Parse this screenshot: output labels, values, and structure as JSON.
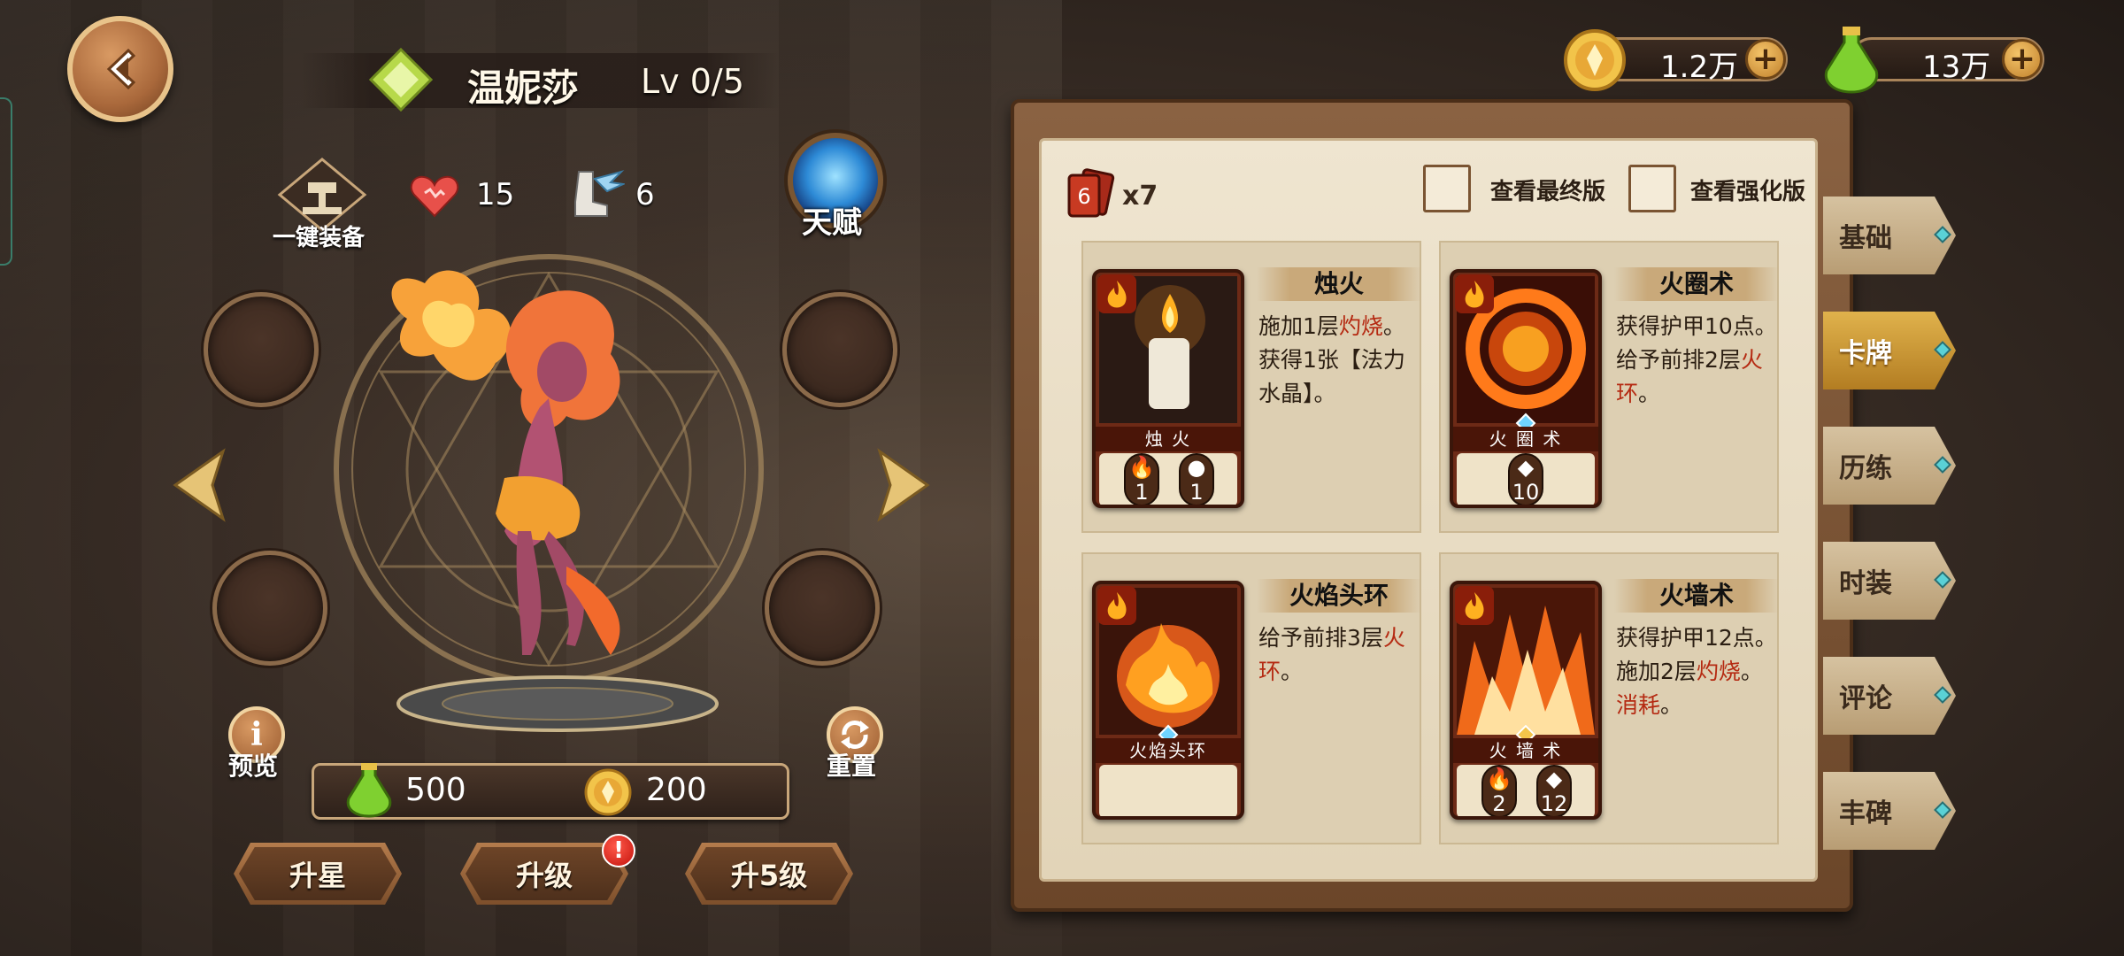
{
  "hero": {
    "name": "温妮莎",
    "level": "Lv 0/5"
  },
  "stats": {
    "equip_label": "一键装备",
    "hp": "15",
    "speed": "6",
    "talent_label": "天赋"
  },
  "actions": {
    "preview_icon": "i",
    "preview_label": "预览",
    "reset_label": "重置"
  },
  "cost": {
    "gem": "500",
    "coin": "200"
  },
  "buttons": {
    "star": "升星",
    "level": "升级",
    "level5": "升5级",
    "alert": "!"
  },
  "currency": {
    "coin": "1.2万",
    "gem": "13万",
    "plus": "+"
  },
  "deck": {
    "count": "x7",
    "view_final": "查看最终版",
    "view_enhanced": "查看强化版"
  },
  "cards": [
    {
      "title": "烛火",
      "plate": "烛 火",
      "desc_html": "施加1层<span class=\"red\">灼烧</span>。获得1张【法力水晶】。",
      "stat1": "1",
      "stat2": "1"
    },
    {
      "title": "火圈术",
      "plate": "火 圈 术",
      "desc_html": "获得护甲10点。给予前排2层<span class=\"red\">火环</span>。",
      "stat1": "10"
    },
    {
      "title": "火焰头环",
      "plate": "火焰头环",
      "desc_html": "给予前排3层<span class=\"red\">火环</span>。"
    },
    {
      "title": "火墙术",
      "plate": "火 墙 术",
      "desc_html": "获得护甲12点。施加2层<span class=\"red\">灼烧</span>。<span class=\"red\">消耗</span>。",
      "stat1": "2",
      "stat2": "12"
    }
  ],
  "tabs": [
    "基础",
    "卡牌",
    "历练",
    "时装",
    "评论",
    "丰碑"
  ],
  "active_tab": "卡牌",
  "colors": {
    "accent_gold": "#e0b24c",
    "keyword_red": "#b52a12",
    "card_red": "#6d2a16"
  }
}
